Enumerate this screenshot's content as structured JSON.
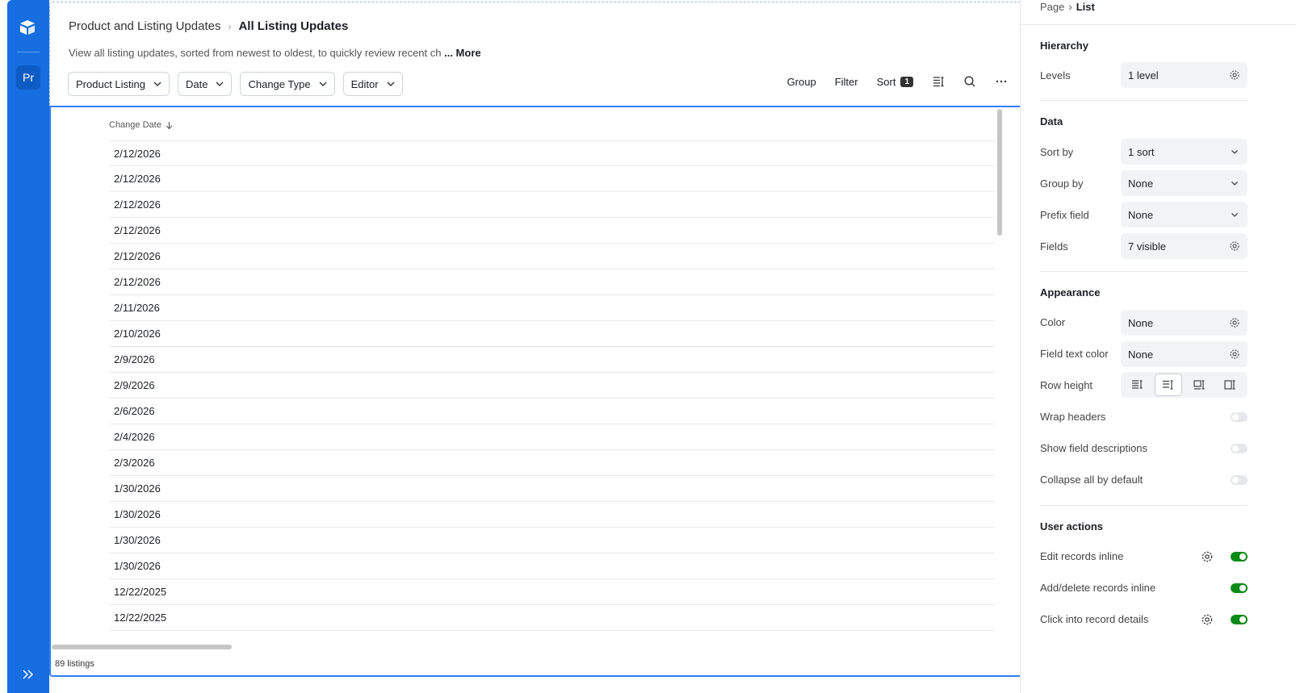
{
  "rail": {
    "app_initials": "Pr"
  },
  "header": {
    "breadcrumb_parent": "Product and Listing Updates",
    "breadcrumb_current": "All Listing Updates",
    "description": "View all listing updates, sorted from newest to oldest, to quickly review recent ch",
    "more_label": "... More",
    "filters": [
      "Product Listing",
      "Date",
      "Change Type",
      "Editor"
    ],
    "tools": {
      "group": "Group",
      "filter": "Filter",
      "sort": "Sort",
      "sort_count": "1"
    }
  },
  "list": {
    "column_header": "Change Date",
    "rows": [
      "2/12/2026",
      "2/12/2026",
      "2/12/2026",
      "2/12/2026",
      "2/12/2026",
      "2/12/2026",
      "2/11/2026",
      "2/10/2026",
      "2/9/2026",
      "2/9/2026",
      "2/6/2026",
      "2/4/2026",
      "2/3/2026",
      "1/30/2026",
      "1/30/2026",
      "1/30/2026",
      "1/30/2026",
      "12/22/2025",
      "12/22/2025"
    ],
    "count_label": "89 listings"
  },
  "panel": {
    "crumb_page": "Page",
    "crumb_current": "List",
    "hierarchy": {
      "title": "Hierarchy",
      "levels_label": "Levels",
      "levels_value": "1 level"
    },
    "data": {
      "title": "Data",
      "sort_label": "Sort by",
      "sort_value": "1 sort",
      "group_label": "Group by",
      "group_value": "None",
      "prefix_label": "Prefix field",
      "prefix_value": "None",
      "fields_label": "Fields",
      "fields_value": "7 visible"
    },
    "appearance": {
      "title": "Appearance",
      "color_label": "Color",
      "color_value": "None",
      "ftc_label": "Field text color",
      "ftc_value": "None",
      "row_height_label": "Row height",
      "wrap_label": "Wrap headers",
      "desc_label": "Show field descriptions",
      "collapse_label": "Collapse all by default"
    },
    "user_actions": {
      "title": "User actions",
      "edit_label": "Edit records inline",
      "add_label": "Add/delete records inline",
      "click_label": "Click into record details"
    }
  },
  "colors": {
    "rail": "#166ee1",
    "accent": "#2d7ff9",
    "toggle_on": "#0a8a16"
  }
}
